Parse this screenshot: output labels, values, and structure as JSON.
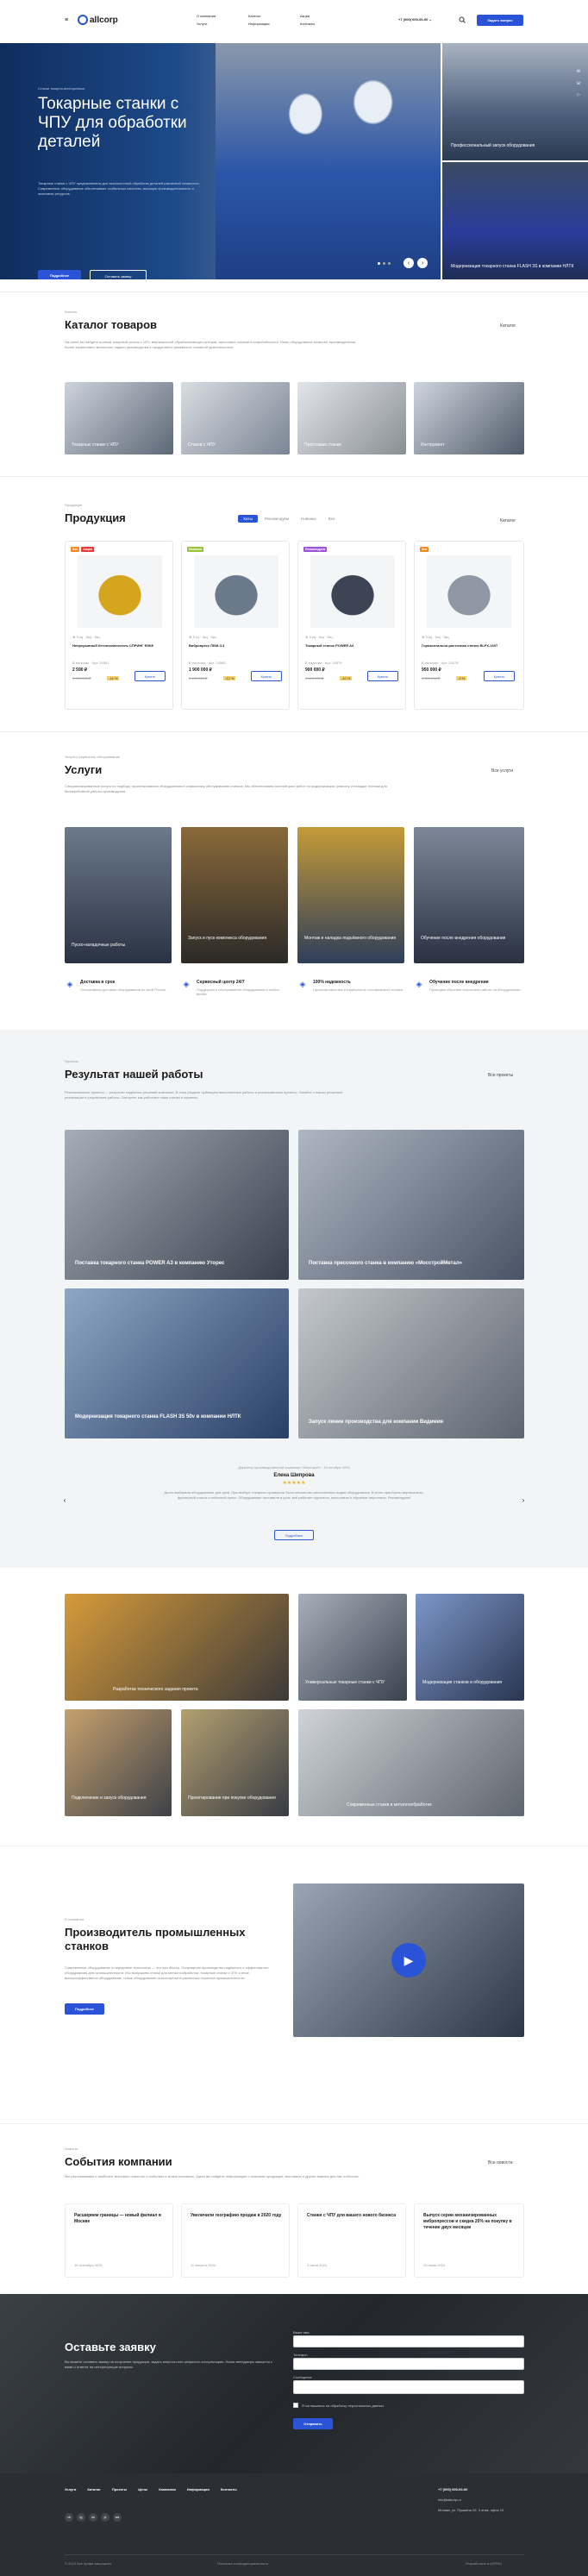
{
  "header": {
    "logo": "allcorp",
    "nav": [
      [
        "О компании",
        "Услуги"
      ],
      [
        "Каталог",
        "Информация"
      ],
      [
        "Акции",
        "Контакты"
      ]
    ],
    "phone": "+7 (000) 000-00-00",
    "phone_arrow": "⌄",
    "cta": "Задать вопрос"
  },
  "hero": {
    "eyebrow": "Станки токарно-винторезные",
    "title": "Токарные станки с ЧПУ для обработки деталей",
    "text": "Токарные станки с ЧПУ предназначены для высокоточной обработки деталей различной сложности. Современное оборудование обеспечивает стабильное качество, высокую производительность и экономию ресурсов.",
    "btn1": "Подробнее",
    "btn2": "Оставить заявку",
    "side1": "Профессиональный запуск оборудования",
    "side2": "Модернизация токарного станка FLASH 3S в компании НЛТК",
    "page_left": "‹",
    "page_right": "›"
  },
  "catalog": {
    "eyebrow": "Каталог",
    "title": "Каталог товаров",
    "link": "Каталог",
    "text": "На сайте вы найдете полный товарный список с ЧПУ, вертикальной обрабатывающих центров, прессовых станков и инфобиблиотек. Наше оборудование позволит производителям более эффективно выполнять задачи производства и продуктивно заниматься основной деятельностью.",
    "items": [
      "Токарные станки с ЧПУ",
      "Станки с ЧПУ",
      "Прессовые станки",
      "Инструмент"
    ]
  },
  "products": {
    "eyebrow": "Продукция",
    "title": "Продукция",
    "link": "Каталог",
    "tabs": [
      "Хиты",
      "Рекомендуем",
      "Новинки",
      "Все"
    ],
    "items": [
      {
        "badges": [
          "Хит",
          "Акция"
        ],
        "badge_colors": [
          "#f08a24",
          "#e23c3c"
        ],
        "rating": "★ 5 кц · 5кц · 5кц",
        "name": "Непрерывный бетоносмеситель СПРИНГ ЯЗКЕ",
        "price": "2 590 ₽",
        "old": "3 000 000 ₽",
        "sale": "-14 %",
        "meta": "В наличии · Арт. 24581",
        "btn": "Купить"
      },
      {
        "badges": [
          "Новинка"
        ],
        "badge_colors": [
          "#9bc43a"
        ],
        "rating": "★ 5 кц · 5кц · 5кц",
        "name": "Вибропресс ПБМ-3.3",
        "price": "1 900 000 ₽",
        "old": "2 150 000 ₽",
        "sale": "-12 %",
        "meta": "В наличии · Арт. 24580",
        "btn": "Купить"
      },
      {
        "badges": [
          "Рекомендуем"
        ],
        "badge_colors": [
          "#9c52d6"
        ],
        "rating": "★ 5 кц · 5кц · 5кц",
        "name": "Токарный станок POWER A3",
        "price": "900 000 ₽",
        "old": "1 000 000 ₽",
        "sale": "-10 %",
        "meta": "В наличии · Арт. 24579",
        "btn": "Купить"
      },
      {
        "badges": [
          "Хит"
        ],
        "badge_colors": [
          "#f08a24"
        ],
        "rating": "★ 5 кц · 5кц · 5кц",
        "name": "Горизонтально-расточная станок BLFX-160Т",
        "price": "950 000 ₽",
        "old": "1 050 000 ₽",
        "sale": "-9 %",
        "meta": "В наличии · Арт. 24578",
        "btn": "Купить"
      }
    ]
  },
  "services": {
    "eyebrow": "Услуги и сервисное обслуживание",
    "title": "Услуги",
    "link": "Все услуги",
    "text": "Специализированные услуги по подбору, проектированию оборудования и сервисному обслуживанию станков. Мы обеспечиваем полный цикл работ по модернизации, ремонту и наладке техники для бесперебойной работы производства.",
    "items": [
      "Пуско-наладочные работы",
      "Запуск и пуск комплекса оборудования",
      "Монтаж и наладка подъёмного оборудования",
      "Обучение после внедрения оборудования"
    ],
    "features": [
      {
        "title": "Доставка в срок",
        "text": "Оперативная доставка оборудования по всей России"
      },
      {
        "title": "Сервисный центр 24/7",
        "text": "Поддержка и обслуживание оборудования в любое время"
      },
      {
        "title": "100% надежность",
        "text": "Гарантия качества и надёжности поставляемой техники"
      },
      {
        "title": "Обучение после внедрения",
        "text": "Проводим обучение персонала работе на оборудовании"
      }
    ]
  },
  "results": {
    "eyebrow": "Проекты",
    "title": "Результат нашей работы",
    "link": "Все проекты",
    "text": "Реализованные проекты — результат надёжных решений компании. В этом разделе публикуем выполненные работы и реализованные проекты. Узнайте о наших решениях реализации и результатах работы. Смотрите как работают наши станки и сервисы.",
    "items": [
      "Поставка токарного станка POWER A3 в компанию Уторес",
      "Поставка прессового станка в компанию «МосстройМетал»",
      "Модернизация токарного станка FLASH 3S 50v в компании НЛТК",
      "Запуск линии производства для компании Видимия"
    ]
  },
  "review": {
    "meta": "Директор производственной компании «Мосстрой» · 15 октября 2024",
    "name": "Елена Шипрова",
    "stars": "★★★★★",
    "text": "Долго выбирали оборудование для цеха. При выборе токарных проверили было множество качественных видов оборудования. В итоге приобрели вертикально-фрезерный станок и гибочный пресс. Оборудование поставили в срок, всё работает идеально, выполнили и обучение персонала. Рекомендуем!",
    "btn": "Подробнее",
    "prev": "‹",
    "next": "›"
  },
  "gallery": {
    "items": [
      "Разработка технического задания проекта",
      "Универсальные токарные станки с ЧПУ",
      "Модернизация станков и оборудования",
      "Подключение и запуск оборудования",
      "Проектирование при покупке оборудования",
      "Современные станки в металлообработке"
    ]
  },
  "about": {
    "eyebrow": "О компании",
    "title": "Производитель промышленных станков",
    "text": "Современное оборудование и передовые технологии — это про Allcorp. Популярная производство надёжного и эффективного оборудования для промышленности. Мы выпускаем станки для металлообработки, токарные станки с ЧПУ и иное высокоэффективное оборудование. Наше оборудование используется в различных отраслях промышленности.",
    "btn": "Подробнее"
  },
  "events": {
    "eyebrow": "Новости",
    "title": "События компании",
    "link": "Все новости",
    "text": "Мы рассказываем о наиболее значимых новостях и событиях в жизни компании. Здесь вы найдёте информацию о новинках продукции, выставках и других важных для нас событиях.",
    "items": [
      {
        "title": "Расширяем границы — новый филиал в Москве",
        "date": "15 сентября 2024"
      },
      {
        "title": "Увеличили географию продаж в 2020 году",
        "date": "11 августа 2024"
      },
      {
        "title": "Станки с ЧПУ для вашего нового бизнеса",
        "date": "3 июля 2024"
      },
      {
        "title": "Выпуск серии механизированных вибропрессов и скидка 20% на покупку в течение двух месяцев",
        "date": "20 июня 2024"
      }
    ]
  },
  "form": {
    "title": "Оставьте заявку",
    "text": "Вы можете оставить заявку на получение продукции, задать вопросы или запросить консультацию. Наши менеджеры свяжутся с вами и ответят на интересующие вопросы.",
    "label_name": "Ваше имя",
    "label_phone": "Телефон",
    "label_msg": "Сообщение",
    "agree": "Я соглашаюсь на обработку персональных данных",
    "btn": "Отправить"
  },
  "footer": {
    "nav": [
      "Услуги",
      "Каталог",
      "Проекты",
      "Цены",
      "Компания",
      "Информация",
      "Контакты"
    ],
    "phone": "+7 (000) 000-00-00",
    "email": "info@allcorp.ru",
    "address": "Москва, ул. Пушкина 20, 3 этаж, офис 10",
    "copyright": "© 2024 Все права защищены",
    "policy": "Политика конфиденциальности",
    "dev": "Разработано в ASPRO",
    "socials": [
      "vk",
      "tg",
      "ok",
      "yt",
      "wa"
    ]
  }
}
